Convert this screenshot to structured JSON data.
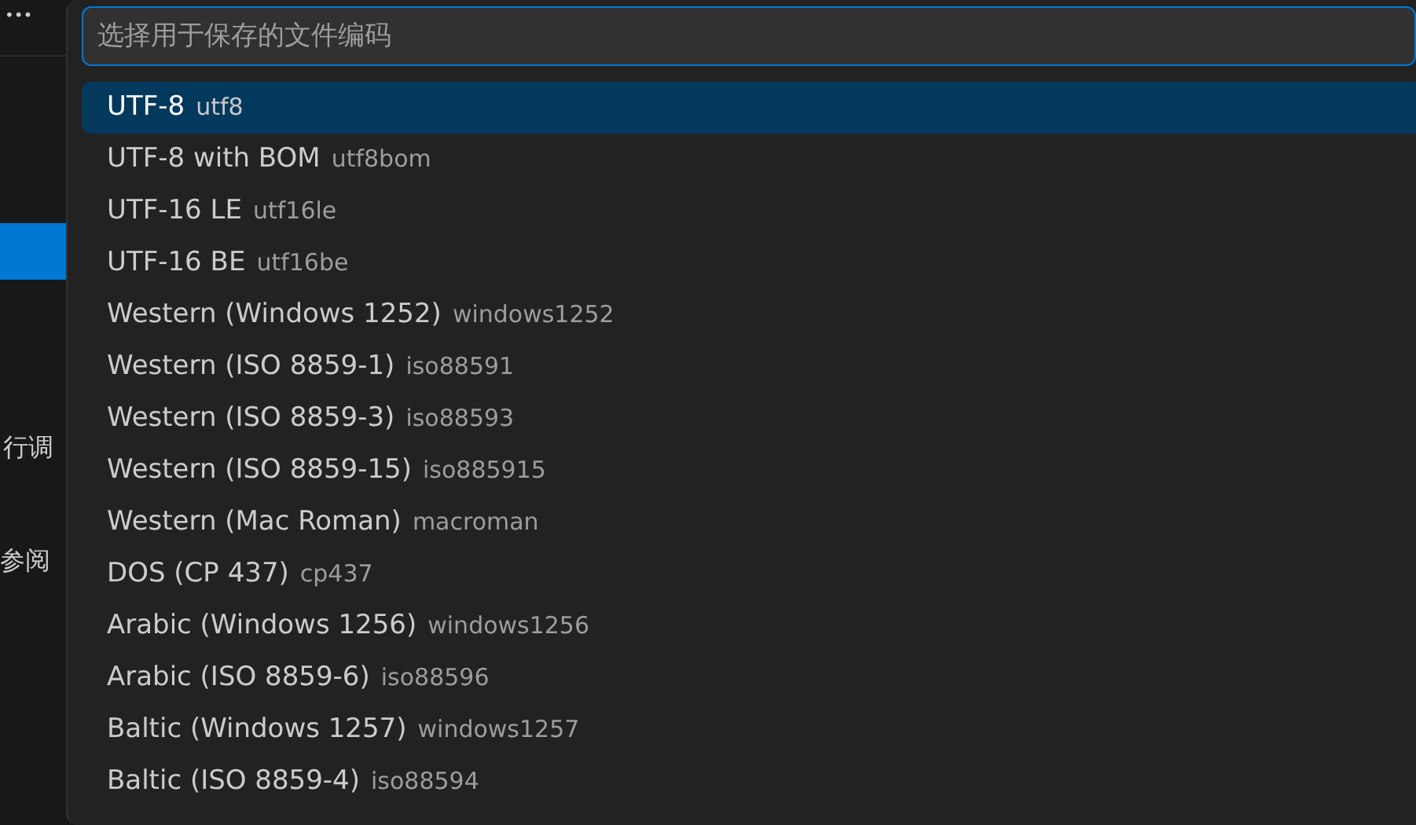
{
  "sidebar": {
    "more_icon": "•••",
    "texts": [
      "行调",
      "参阅"
    ]
  },
  "quick_pick": {
    "placeholder": "选择用于保存的文件编码",
    "items": [
      {
        "label": "UTF-8",
        "detail": "utf8",
        "selected": true
      },
      {
        "label": "UTF-8 with BOM",
        "detail": "utf8bom",
        "selected": false
      },
      {
        "label": "UTF-16 LE",
        "detail": "utf16le",
        "selected": false
      },
      {
        "label": "UTF-16 BE",
        "detail": "utf16be",
        "selected": false
      },
      {
        "label": "Western (Windows 1252)",
        "detail": "windows1252",
        "selected": false
      },
      {
        "label": "Western (ISO 8859-1)",
        "detail": "iso88591",
        "selected": false
      },
      {
        "label": "Western (ISO 8859-3)",
        "detail": "iso88593",
        "selected": false
      },
      {
        "label": "Western (ISO 8859-15)",
        "detail": "iso885915",
        "selected": false
      },
      {
        "label": "Western (Mac Roman)",
        "detail": "macroman",
        "selected": false
      },
      {
        "label": "DOS (CP 437)",
        "detail": "cp437",
        "selected": false
      },
      {
        "label": "Arabic (Windows 1256)",
        "detail": "windows1256",
        "selected": false
      },
      {
        "label": "Arabic (ISO 8859-6)",
        "detail": "iso88596",
        "selected": false
      },
      {
        "label": "Baltic (Windows 1257)",
        "detail": "windows1257",
        "selected": false
      },
      {
        "label": "Baltic (ISO 8859-4)",
        "detail": "iso88594",
        "selected": false
      }
    ]
  }
}
